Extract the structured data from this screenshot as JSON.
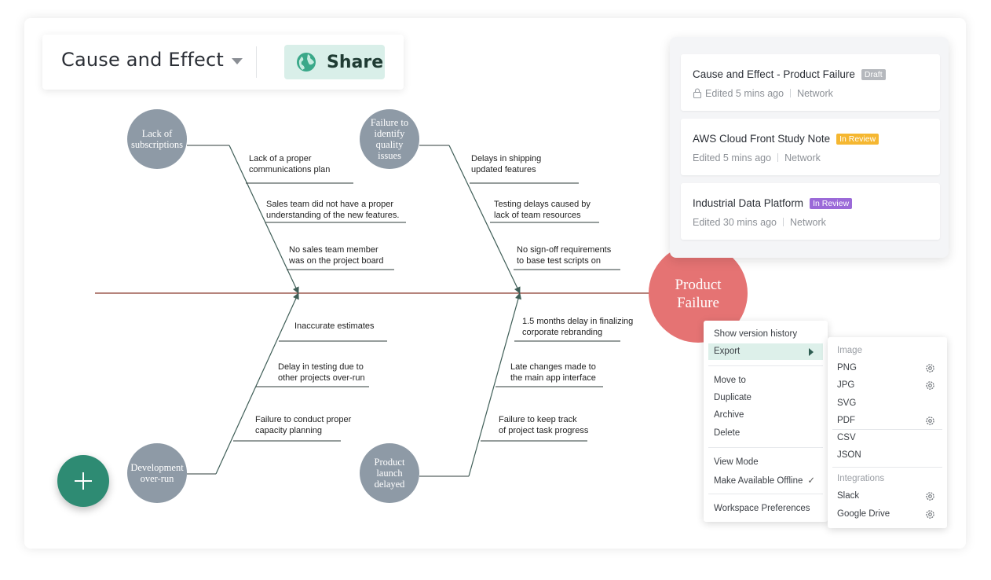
{
  "header": {
    "title": "Cause and Effect",
    "share_label": "Share",
    "share_icon": "globe-icon"
  },
  "diagram": {
    "effect": "Product Failure",
    "effect_lines": [
      "Product",
      "Failure"
    ],
    "categories": [
      {
        "id": "cat1",
        "lines": [
          "Lack of",
          "subscriptions"
        ],
        "causes": [
          [
            "Lack of a proper",
            "communications plan"
          ],
          [
            "Sales team did not have a proper",
            "understanding of the new features."
          ],
          [
            "No sales team member",
            "was on the project board"
          ]
        ]
      },
      {
        "id": "cat2",
        "lines": [
          "Failure to",
          "identify",
          "quality",
          "issues"
        ],
        "causes": [
          [
            "Delays in shipping",
            "updated features"
          ],
          [
            "Testing  delays caused by",
            "lack of team resources"
          ],
          [
            "No sign-off requirements",
            "to base test scripts on"
          ]
        ]
      },
      {
        "id": "cat3",
        "lines": [
          "Development",
          "over-run"
        ],
        "causes": [
          [
            "Inaccurate estimates"
          ],
          [
            "Delay in testing due to",
            "other projects over-run"
          ],
          [
            "Failure to conduct proper",
            "capacity planning"
          ]
        ]
      },
      {
        "id": "cat4",
        "lines": [
          "Product",
          "launch",
          "delayed"
        ],
        "causes": [
          [
            "1.5 months delay in finalizing",
            "corporate rebranding"
          ],
          [
            "Late changes made to",
            "the main app interface"
          ],
          [
            "Failure to keep track",
            "of project task progress"
          ]
        ]
      }
    ],
    "colors": {
      "category_node": "#8e9aa6",
      "effect_node": "#e57373",
      "spine": "#8b3a2e",
      "arrow": "#3f5e57"
    }
  },
  "documents": [
    {
      "title": "Cause and Effect - Product Failure",
      "badge": "Draft",
      "badge_color": "#b5b8bd",
      "edited": "Edited 5 mins ago",
      "location": "Network",
      "locked": true
    },
    {
      "title": "AWS Cloud Front Study Note",
      "badge": "In Review",
      "badge_color": "#f5b731",
      "edited": "Edited 5 mins ago",
      "location": "Network",
      "locked": false
    },
    {
      "title": "Industrial Data Platform",
      "badge": "In Review",
      "badge_color": "#9b6ad8",
      "edited": "Edited 30 mins ago",
      "location": "Network",
      "locked": false
    }
  ],
  "context_menu": {
    "items": [
      "Show version history",
      "Export",
      "Move to",
      "Duplicate",
      "Archive",
      "Delete",
      "View Mode",
      "Make Available Offline",
      "Workspace Preferences"
    ],
    "offline_checked": "✓"
  },
  "export_submenu": {
    "image_header": "Image",
    "image_formats": [
      "PNG",
      "JPG",
      "SVG",
      "PDF"
    ],
    "data_formats": [
      "CSV",
      "JSON"
    ],
    "integrations_header": "Integrations",
    "integrations": [
      "Slack",
      "Google Drive"
    ]
  }
}
